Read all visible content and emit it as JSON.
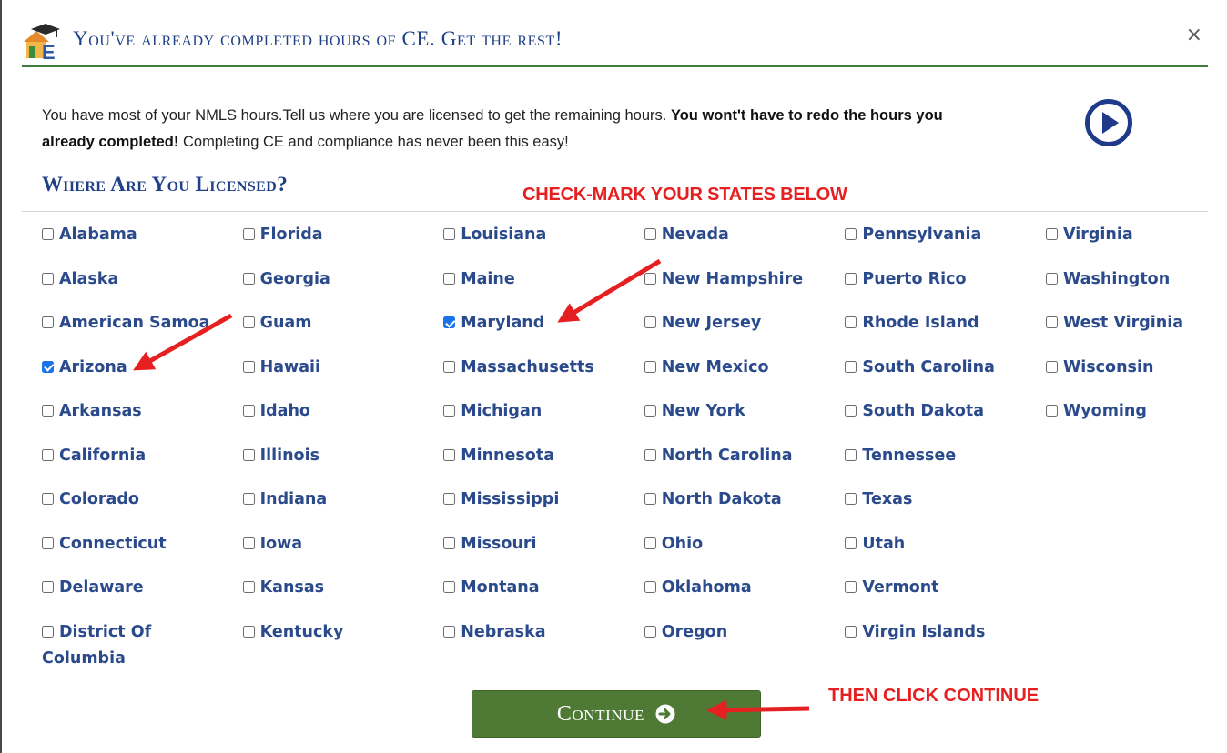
{
  "header": {
    "title": "You've already completed hours of CE. Get the rest!",
    "close": "×"
  },
  "intro": {
    "part1": "You have most of your NMLS hours.Tell us where you are licensed to get the remaining hours. ",
    "bold": "You wont't have to redo the hours you already completed!",
    "part2": " Completing CE and compliance has never been this easy!"
  },
  "section_title": "Where Are You Licensed?",
  "annotations": {
    "top": "CHECK-MARK YOUR STATES BELOW",
    "bottom": "THEN CLICK CONTINUE"
  },
  "states": {
    "c1": [
      {
        "name": "Alabama",
        "checked": false
      },
      {
        "name": "Alaska",
        "checked": false
      },
      {
        "name": "American Samoa",
        "checked": false
      },
      {
        "name": "Arizona",
        "checked": true
      },
      {
        "name": "Arkansas",
        "checked": false
      },
      {
        "name": "California",
        "checked": false
      },
      {
        "name": "Colorado",
        "checked": false
      },
      {
        "name": "Connecticut",
        "checked": false
      },
      {
        "name": "Delaware",
        "checked": false
      },
      {
        "name": "District Of Columbia",
        "checked": false
      }
    ],
    "c2": [
      {
        "name": "Florida",
        "checked": false
      },
      {
        "name": "Georgia",
        "checked": false
      },
      {
        "name": "Guam",
        "checked": false
      },
      {
        "name": "Hawaii",
        "checked": false
      },
      {
        "name": "Idaho",
        "checked": false
      },
      {
        "name": "Illinois",
        "checked": false
      },
      {
        "name": "Indiana",
        "checked": false
      },
      {
        "name": "Iowa",
        "checked": false
      },
      {
        "name": "Kansas",
        "checked": false
      },
      {
        "name": "Kentucky",
        "checked": false
      }
    ],
    "c3": [
      {
        "name": "Louisiana",
        "checked": false
      },
      {
        "name": "Maine",
        "checked": false
      },
      {
        "name": "Maryland",
        "checked": true
      },
      {
        "name": "Massachusetts",
        "checked": false
      },
      {
        "name": "Michigan",
        "checked": false
      },
      {
        "name": "Minnesota",
        "checked": false
      },
      {
        "name": "Mississippi",
        "checked": false
      },
      {
        "name": "Missouri",
        "checked": false
      },
      {
        "name": "Montana",
        "checked": false
      },
      {
        "name": "Nebraska",
        "checked": false
      }
    ],
    "c4": [
      {
        "name": "Nevada",
        "checked": false
      },
      {
        "name": "New Hampshire",
        "checked": false
      },
      {
        "name": "New Jersey",
        "checked": false
      },
      {
        "name": "New Mexico",
        "checked": false
      },
      {
        "name": "New York",
        "checked": false
      },
      {
        "name": "North Carolina",
        "checked": false
      },
      {
        "name": "North Dakota",
        "checked": false
      },
      {
        "name": "Ohio",
        "checked": false
      },
      {
        "name": "Oklahoma",
        "checked": false
      },
      {
        "name": "Oregon",
        "checked": false
      }
    ],
    "c5": [
      {
        "name": "Pennsylvania",
        "checked": false
      },
      {
        "name": "Puerto Rico",
        "checked": false
      },
      {
        "name": "Rhode Island",
        "checked": false
      },
      {
        "name": "South Carolina",
        "checked": false
      },
      {
        "name": "South Dakota",
        "checked": false
      },
      {
        "name": "Tennessee",
        "checked": false
      },
      {
        "name": "Texas",
        "checked": false
      },
      {
        "name": "Utah",
        "checked": false
      },
      {
        "name": "Vermont",
        "checked": false
      },
      {
        "name": "Virgin Islands",
        "checked": false
      }
    ],
    "c6": [
      {
        "name": "Virginia",
        "checked": false
      },
      {
        "name": "Washington",
        "checked": false
      },
      {
        "name": "West Virginia",
        "checked": false
      },
      {
        "name": "Wisconsin",
        "checked": false
      },
      {
        "name": "Wyoming",
        "checked": false
      }
    ]
  },
  "continue_button": {
    "label": "Continue"
  },
  "colors": {
    "title_blue": "#1f3f86",
    "state_blue": "#2b4a8c",
    "accent_green": "#4f7a35",
    "annotation_red": "#e62020",
    "checkbox_blue": "#1a73e8"
  },
  "icons": {
    "logo": "graduation-cap-house-e-logo",
    "play": "circled-play-icon",
    "close": "close-icon",
    "continue": "circled-arrow-right-icon"
  }
}
